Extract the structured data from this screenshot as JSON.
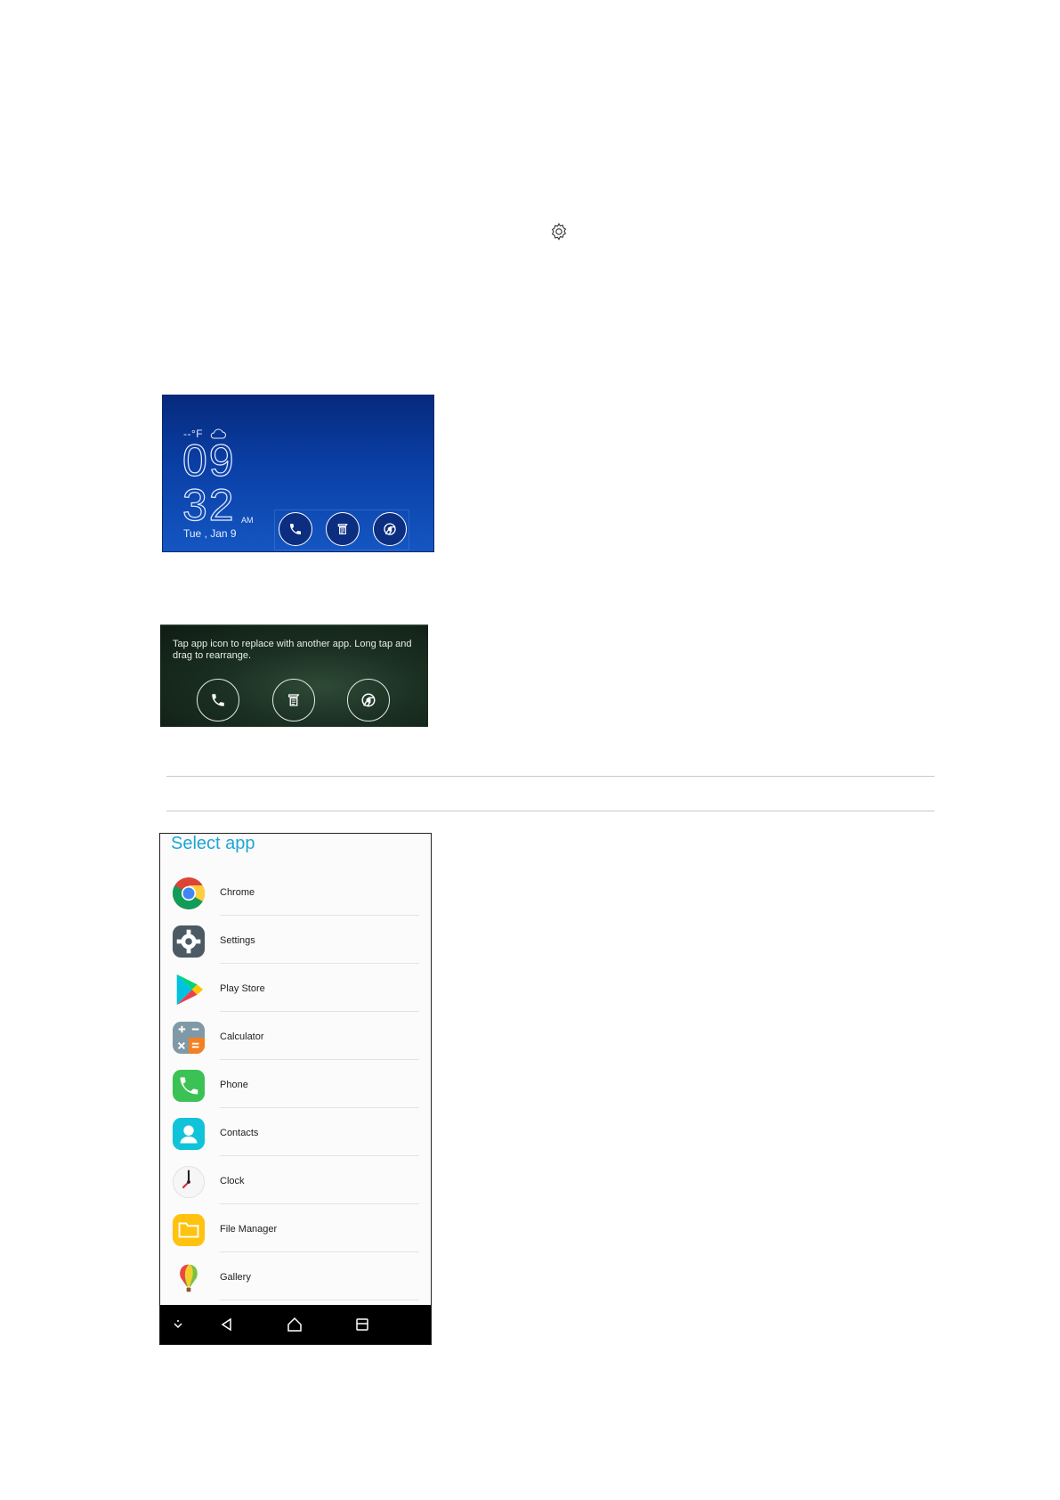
{
  "lock_screen": {
    "temperature": "--°F",
    "hour": "09",
    "minute": "32",
    "ampm": "AM",
    "date": "Tue , Jan 9",
    "shortcuts": [
      "phone-icon",
      "memo-icon",
      "chrome-icon"
    ],
    "colors": {
      "background": "#0a3fa6"
    }
  },
  "edit_panel": {
    "hint": "Tap app icon to replace with another app. Long tap and drag to rearrange.",
    "shortcuts": [
      "phone-icon",
      "memo-icon",
      "chrome-icon"
    ]
  },
  "select_app": {
    "title": "Select app",
    "apps": [
      {
        "label": "Chrome",
        "icon": "chrome-icon"
      },
      {
        "label": "Settings",
        "icon": "settings-icon"
      },
      {
        "label": "Play Store",
        "icon": "play-store-icon"
      },
      {
        "label": "Calculator",
        "icon": "calculator-icon"
      },
      {
        "label": "Phone",
        "icon": "phone-icon"
      },
      {
        "label": "Contacts",
        "icon": "contacts-icon"
      },
      {
        "label": "Clock",
        "icon": "clock-icon"
      },
      {
        "label": "File Manager",
        "icon": "file-manager-icon"
      },
      {
        "label": "Gallery",
        "icon": "gallery-icon"
      }
    ],
    "navbar": [
      "collapse-icon",
      "back-icon",
      "home-icon",
      "recents-icon"
    ],
    "colors": {
      "title": "#1fa5d6",
      "navbar": "#000000"
    }
  }
}
